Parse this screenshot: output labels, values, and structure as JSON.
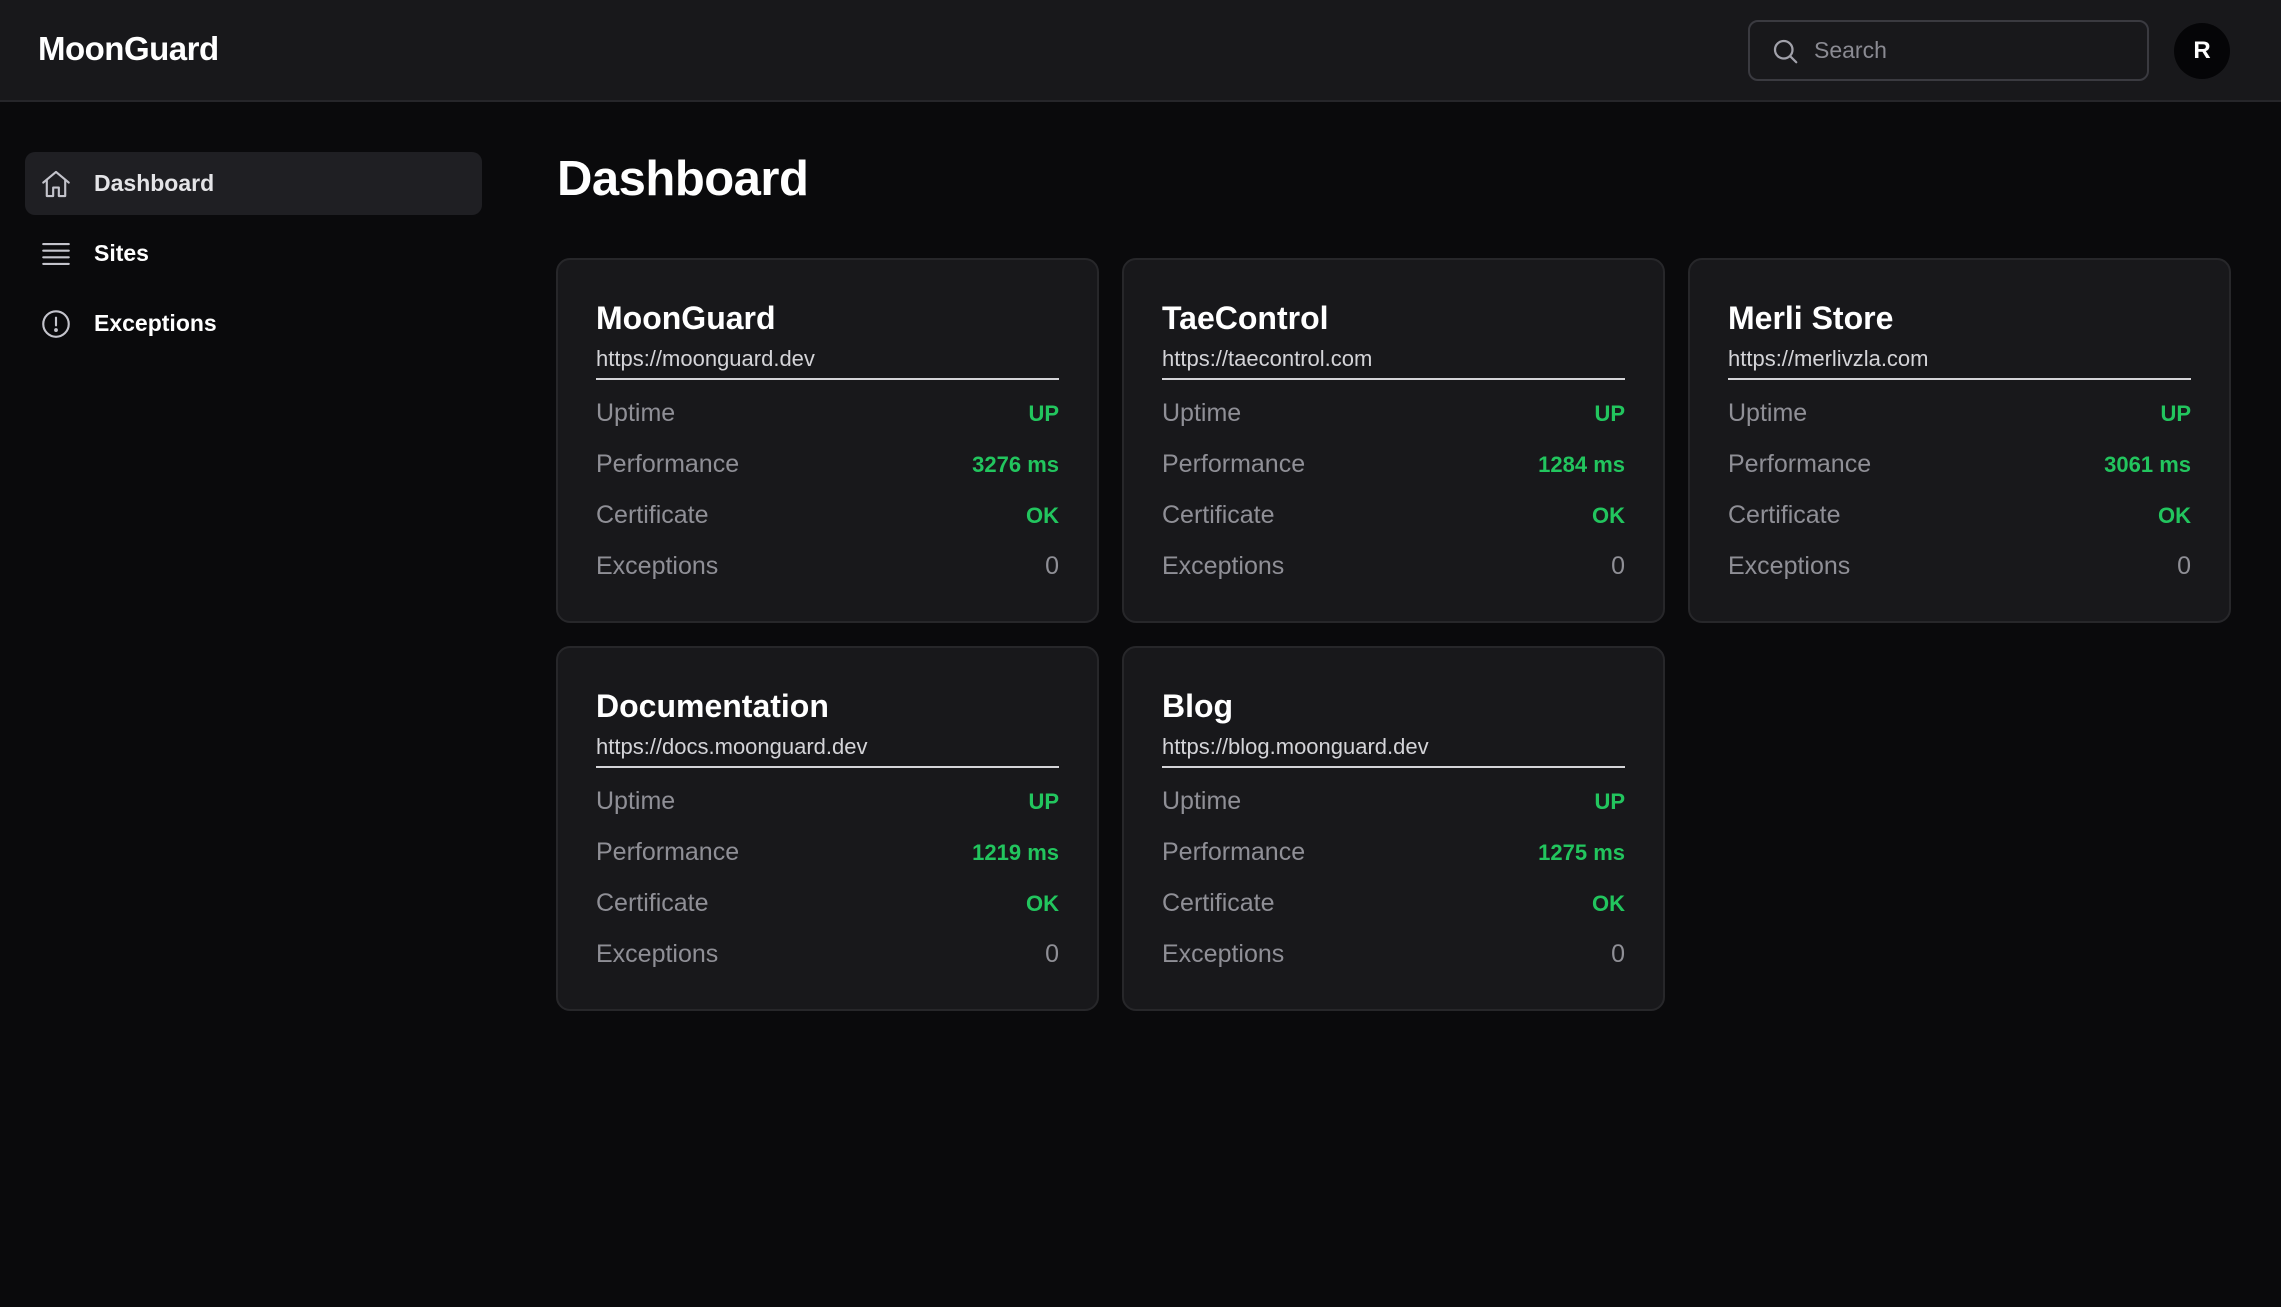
{
  "app": {
    "brand": "MoonGuard"
  },
  "header": {
    "search_placeholder": "Search",
    "avatar_initial": "R"
  },
  "sidebar": {
    "items": [
      {
        "label": "Dashboard",
        "icon": "home-icon",
        "active": true
      },
      {
        "label": "Sites",
        "icon": "list-icon",
        "active": false
      },
      {
        "label": "Exceptions",
        "icon": "alert-circle-icon",
        "active": false
      }
    ]
  },
  "main": {
    "title": "Dashboard",
    "metric_labels": {
      "uptime": "Uptime",
      "performance": "Performance",
      "certificate": "Certificate",
      "exceptions": "Exceptions"
    },
    "sites": [
      {
        "name": "MoonGuard",
        "url": "https://moonguard.dev",
        "uptime": "UP",
        "performance": "3276 ms",
        "certificate": "OK",
        "exceptions": "0"
      },
      {
        "name": "TaeControl",
        "url": "https://taecontrol.com",
        "uptime": "UP",
        "performance": "1284 ms",
        "certificate": "OK",
        "exceptions": "0"
      },
      {
        "name": "Merli Store",
        "url": "https://merlivzla.com",
        "uptime": "UP",
        "performance": "3061 ms",
        "certificate": "OK",
        "exceptions": "0"
      },
      {
        "name": "Documentation",
        "url": "https://docs.moonguard.dev",
        "uptime": "UP",
        "performance": "1219 ms",
        "certificate": "OK",
        "exceptions": "0"
      },
      {
        "name": "Blog",
        "url": "https://blog.moonguard.dev",
        "uptime": "UP",
        "performance": "1275 ms",
        "certificate": "OK",
        "exceptions": "0"
      }
    ]
  },
  "colors": {
    "background": "#0a0a0c",
    "surface": "#18181b",
    "status_ok": "#22c55e",
    "muted_text": "#8f8f96"
  }
}
